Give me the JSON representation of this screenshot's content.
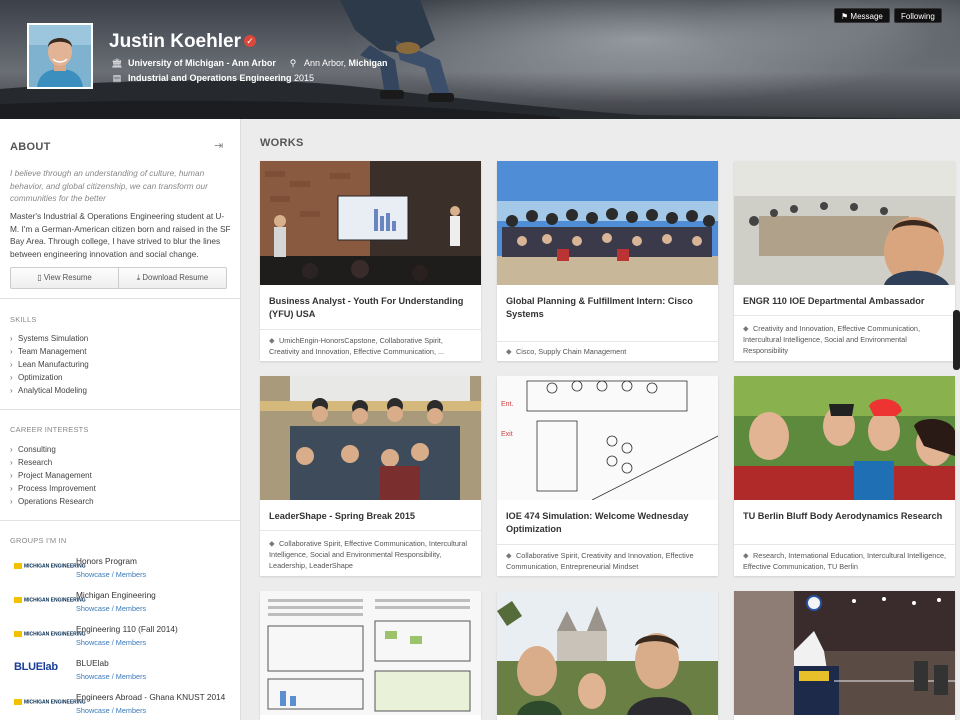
{
  "profile": {
    "name": "Justin Koehler",
    "university": "University of Michigan - Ann Arbor",
    "location_city": "Ann Arbor, ",
    "location_state": "Michigan",
    "program": "Industrial and Operations Engineering",
    "year": " 2015"
  },
  "header_buttons": {
    "message": "Message",
    "following": "Following"
  },
  "about": {
    "title": "ABOUT",
    "quote": "I believe through an understanding of culture, human behavior, and global citizenship, we can transform our communities for the better",
    "bio": "Master's Industrial & Operations Engineering student at U-M. I'm a German-American citizen born and raised in the SF Bay Area. Through college, I have strived to blur the lines between engineering innovation and social change.",
    "view_resume": "View Resume",
    "download_resume": "Download Resume"
  },
  "skills": {
    "title": "SKILLS",
    "items": [
      "Systems Simulation",
      "Team Management",
      "Lean Manufacturing",
      "Optimization",
      "Analytical Modeling"
    ]
  },
  "career": {
    "title": "CAREER INTERESTS",
    "items": [
      "Consulting",
      "Research",
      "Project Management",
      "Process Improvement",
      "Operations Research"
    ]
  },
  "groups": {
    "title": "GROUPS I'M IN",
    "logo_text": "MICHIGAN ENGINEERING",
    "bluelab_logo": "BLUElab",
    "link_showcase": "Showcase",
    "link_sep": " / ",
    "link_members": "Members",
    "items": [
      {
        "name": "Honors Program"
      },
      {
        "name": "Michigan Engineering"
      },
      {
        "name": "Engineering 110 (Fall 2014)"
      },
      {
        "name": "BLUElab"
      },
      {
        "name": "Engineers Abroad - Ghana KNUST 2014"
      }
    ]
  },
  "works": {
    "title": "WORKS",
    "items": [
      {
        "title": "Business Analyst - Youth For Understanding (YFU) USA",
        "tags": "UmichEngin-HonorsCapstone, Collaborative Spirit, Creativity and Innovation, Effective Communication,",
        "more": "..."
      },
      {
        "title": "Global Planning & Fulfillment Intern: Cisco Systems",
        "tags": "Cisco, Supply Chain Management"
      },
      {
        "title": "ENGR 110 IOE Departmental Ambassador",
        "tags": "Creativity and Innovation, Effective Communication, Intercultural Intelligence, Social and Environmental Responsibility"
      },
      {
        "title": "LeaderShape - Spring Break 2015",
        "tags": "Collaborative Spirit, Effective Communication, Intercultural Intelligence, Social and Environmental Responsibility, Leadership, LeaderShape"
      },
      {
        "title": "IOE 474 Simulation: Welcome Wednesday Optimization",
        "tags": "Collaborative Spirit, Creativity and Innovation, Effective Communication, Entrepreneurial Mindset"
      },
      {
        "title": "TU Berlin Bluff Body Aerodynamics Research",
        "tags": "Research, International Education, Intercultural Intelligence, Effective Communication, TU Berlin"
      }
    ]
  },
  "colors": {
    "link": "#3a7ab8",
    "verified": "#d9483b",
    "michigan_maize": "#f2c200",
    "michigan_blue": "#00274c"
  },
  "icons": [
    "verified-icon",
    "university-icon",
    "location-icon",
    "book-icon",
    "message-icon",
    "collapse-icon",
    "download-icon",
    "tag-icon"
  ]
}
